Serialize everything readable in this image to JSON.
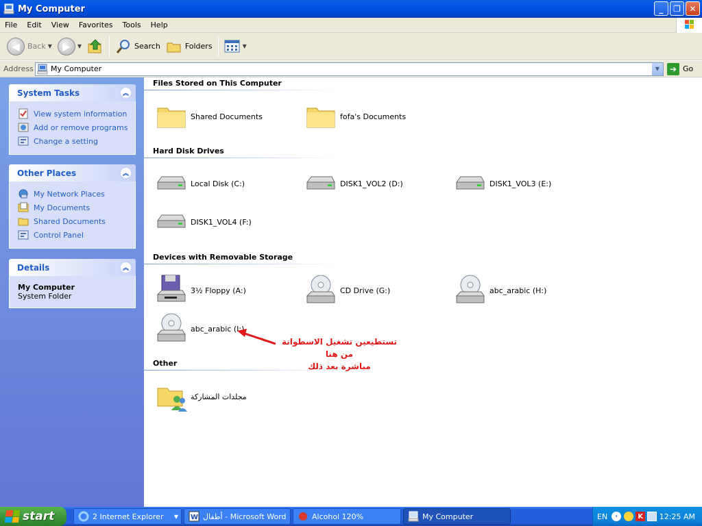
{
  "window": {
    "title": "My Computer"
  },
  "menu": [
    "File",
    "Edit",
    "View",
    "Favorites",
    "Tools",
    "Help"
  ],
  "toolbar": {
    "back": "Back",
    "search": "Search",
    "folders": "Folders"
  },
  "address": {
    "label": "Address",
    "value": "My Computer",
    "go": "Go"
  },
  "tasks_panels": [
    {
      "title": "System Tasks",
      "links": [
        "View system information",
        "Add or remove programs",
        "Change a setting"
      ]
    },
    {
      "title": "Other Places",
      "links": [
        "My Network Places",
        "My Documents",
        "Shared Documents",
        "Control Panel"
      ]
    },
    {
      "title": "Details",
      "name": "My Computer",
      "desc": "System Folder"
    }
  ],
  "sections": {
    "files": "Files Stored on This Computer",
    "hdd": "Hard Disk Drives",
    "removable": "Devices with Removable Storage",
    "other": "Other"
  },
  "files": [
    "Shared Documents",
    "fofa's Documents"
  ],
  "drives": [
    "Local Disk (C:)",
    "DISK1_VOL2 (D:)",
    "DISK1_VOL3 (E:)",
    "DISK1_VOL4 (F:)"
  ],
  "removable": [
    "3½ Floppy (A:)",
    "CD Drive (G:)",
    "abc_arabic (H:)",
    "abc_arabic (I:)"
  ],
  "other": [
    "مجلدات المشاركة"
  ],
  "annotation": {
    "line1": "تستطيعين تشغيل الاسطوانة من هنا",
    "line2": "مباشرة بعد ذلك"
  },
  "taskbar": {
    "start": "start",
    "tasks": [
      "2 Internet Explorer",
      "أطفال - Microsoft Word",
      "Alcohol 120%",
      "My Computer"
    ],
    "lang": "EN",
    "clock": "12:25 AM"
  },
  "colors": {
    "titlebar": "#0054e3",
    "sidebar": "#6f8ee0",
    "link": "#215dc6",
    "annotation": "#e21717",
    "start": "#3c9839"
  }
}
